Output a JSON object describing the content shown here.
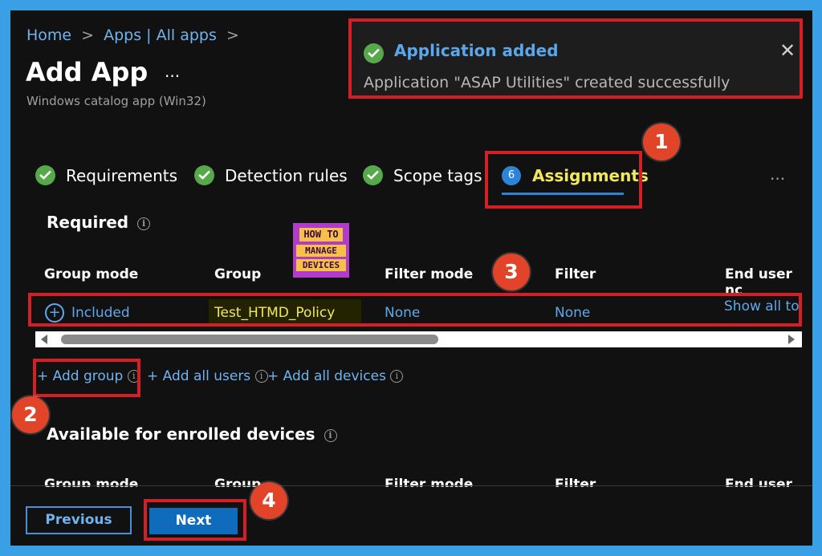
{
  "breadcrumb": {
    "home": "Home",
    "sep1": ">",
    "apps": "Apps | All apps",
    "sep2": ">"
  },
  "page": {
    "title": "Add App",
    "more": "...",
    "subtitle": "Windows catalog app (Win32)"
  },
  "toast": {
    "title": "Application added",
    "message": "Application \"ASAP Utilities\" created successfully",
    "close": "✕"
  },
  "tabs": [
    {
      "label": "Requirements"
    },
    {
      "label": "Detection rules"
    },
    {
      "label": "Scope tags"
    },
    {
      "label": "Assignments",
      "step": "6"
    }
  ],
  "tabs_more": "...",
  "required": {
    "heading": "Required",
    "info": "i"
  },
  "watermark": {
    "line1": "HOW TO",
    "line2": "MANAGE",
    "line3": "DEVICES"
  },
  "table": {
    "headers": [
      "Group mode",
      "Group",
      "Filter mode",
      "Filter",
      "End user nc"
    ],
    "row": {
      "group_mode": "Included",
      "group": "Test_HTMD_Policy",
      "filter_mode": "None",
      "filter": "None",
      "end_user": "Show all to"
    }
  },
  "add_links": {
    "add_group": "+ Add group",
    "add_all_users": "+ Add all users",
    "add_all_devices": "+ Add all devices"
  },
  "available": {
    "heading": "Available for enrolled devices",
    "info": "i"
  },
  "table2_headers": [
    "Group mode",
    "Group",
    "Filter mode",
    "Filter",
    "End user no"
  ],
  "footer": {
    "previous": "Previous",
    "next": "Next"
  },
  "callouts": [
    "1",
    "2",
    "3",
    "4"
  ],
  "colors": {
    "accent_red": "#d41f26",
    "callout": "#e2442a",
    "link": "#6fb3ef",
    "check": "#57a84a",
    "next_bg": "#0f6cbd",
    "assign_text": "#f2e85c"
  }
}
